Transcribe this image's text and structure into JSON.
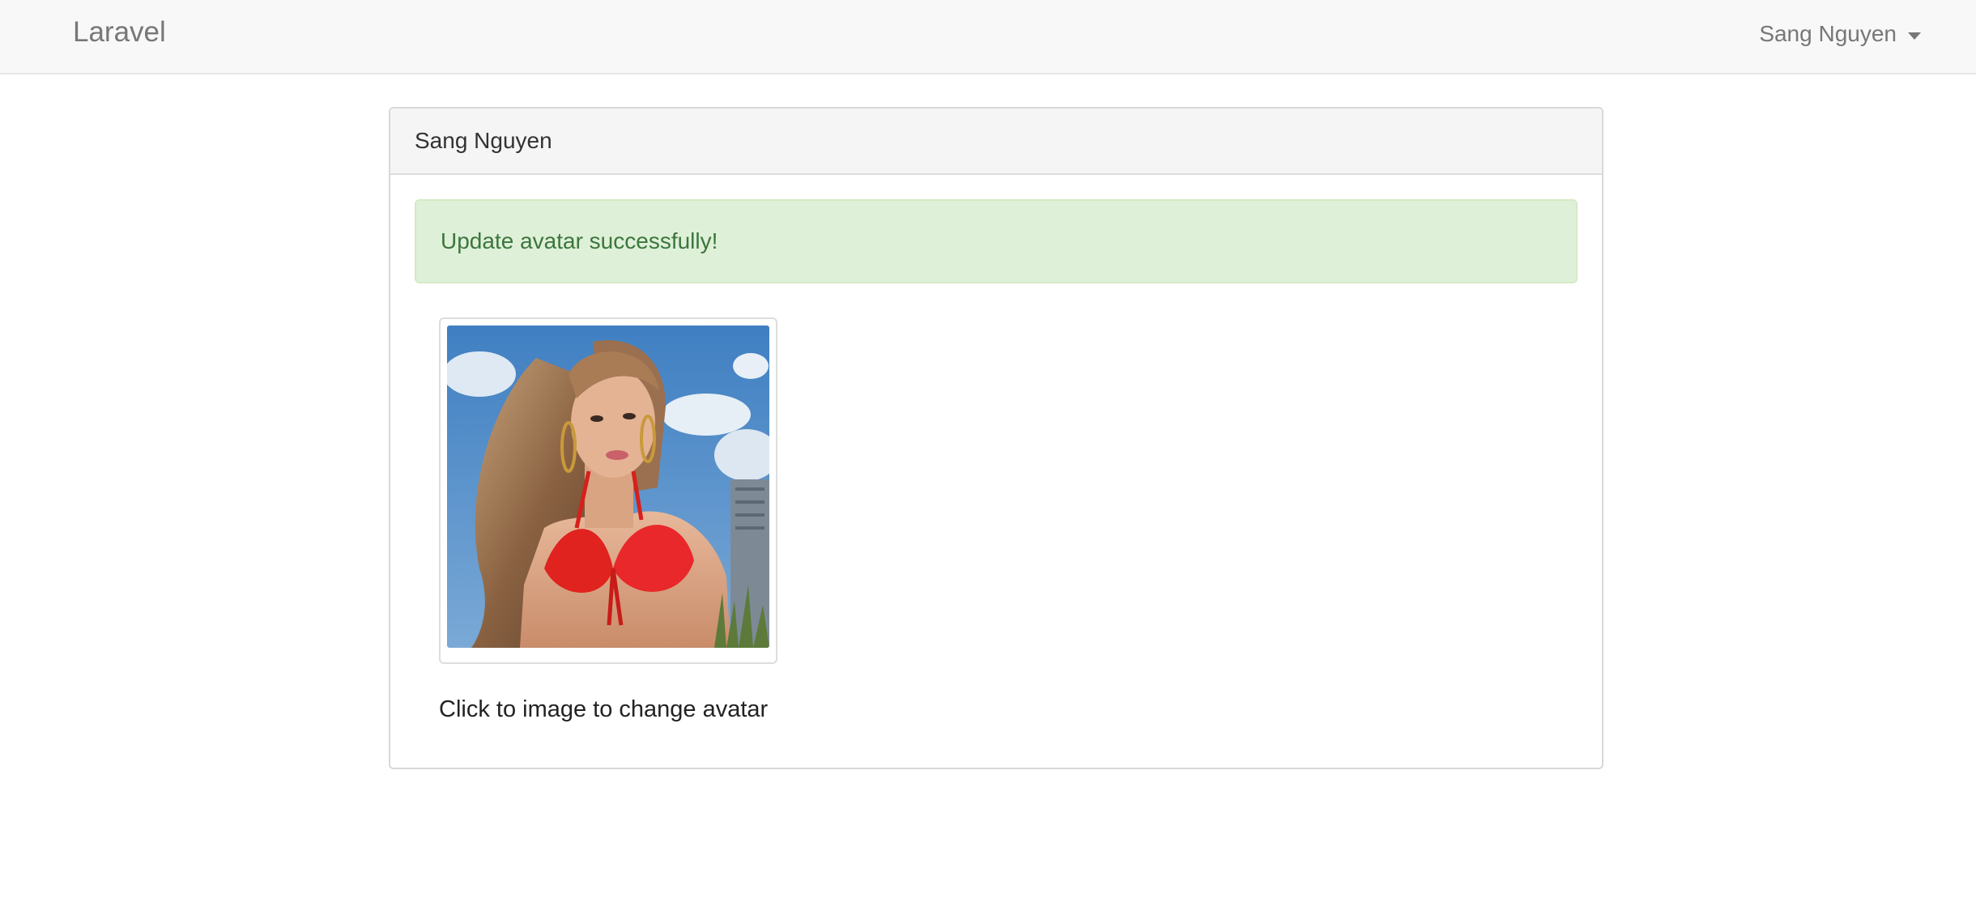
{
  "navbar": {
    "brand": "Laravel",
    "user_name": "Sang Nguyen",
    "dropdown_icon": "caret-down-icon"
  },
  "panel": {
    "heading": "Sang Nguyen",
    "alert_text": "Update avatar successfully!",
    "hint_text": "Click to image to change avatar"
  },
  "colors": {
    "alert_bg": "#dff0d8",
    "alert_text": "#3c763d",
    "navbar_bg": "#f8f8f8"
  }
}
